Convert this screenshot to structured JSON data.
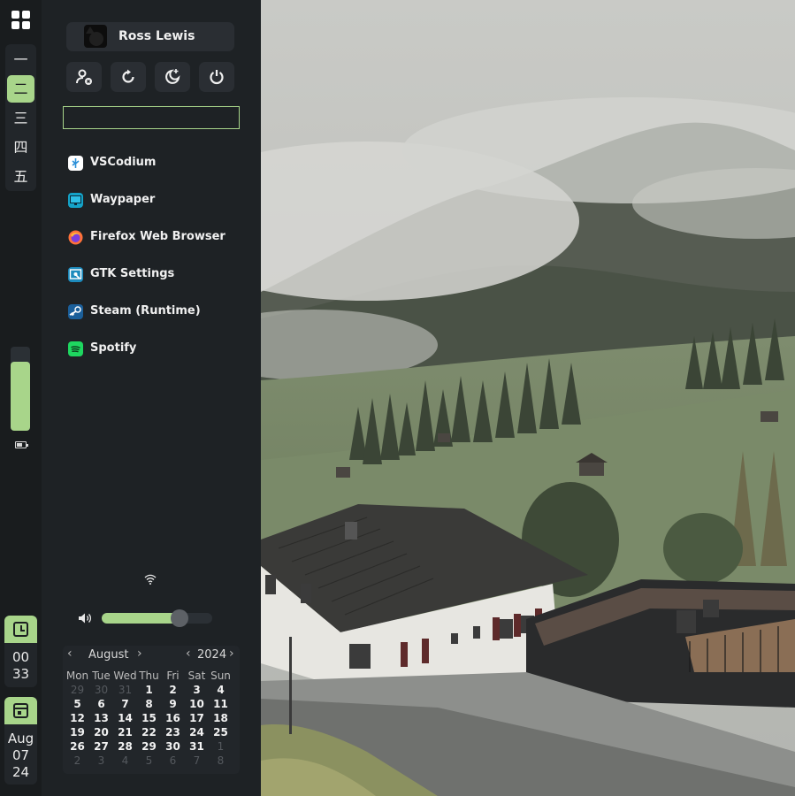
{
  "bar": {
    "workspaces": [
      {
        "label": "一",
        "active": false
      },
      {
        "label": "二",
        "active": true
      },
      {
        "label": "三",
        "active": false
      },
      {
        "label": "四",
        "active": false
      },
      {
        "label": "五",
        "active": false
      }
    ],
    "brightness_level": 0.82,
    "clock": {
      "hour": "00",
      "minute": "33"
    },
    "date": {
      "month": "Aug",
      "day": "07",
      "year": "24"
    }
  },
  "panel": {
    "user_name": "Ross Lewis",
    "power_buttons": [
      "logout-icon",
      "reboot-icon",
      "suspend-icon",
      "shutdown-icon"
    ],
    "search": {
      "value": "",
      "placeholder": ""
    },
    "apps": [
      {
        "label": "VSCodium",
        "icon": "vscodium-icon",
        "color": "#ffffff"
      },
      {
        "label": "Waypaper",
        "icon": "waypaper-icon",
        "color": "#1e8fc0"
      },
      {
        "label": "Firefox Web Browser",
        "icon": "firefox-icon",
        "color": "#ff7139"
      },
      {
        "label": "GTK Settings",
        "icon": "gtk-settings-icon",
        "color": "#2196c8"
      },
      {
        "label": "Steam (Runtime)",
        "icon": "steam-icon",
        "color": "#1b5f9a"
      },
      {
        "label": "Spotify",
        "icon": "spotify-icon",
        "color": "#1ed760"
      }
    ],
    "volume_level": 0.7,
    "calendar": {
      "month": "August",
      "year": "2024",
      "weekdays": [
        "Mon",
        "Tue",
        "Wed",
        "Thu",
        "Fri",
        "Sat",
        "Sun"
      ],
      "days": [
        "29",
        "30",
        "31",
        "1",
        "2",
        "3",
        "4",
        "5",
        "6",
        "7",
        "8",
        "9",
        "10",
        "11",
        "12",
        "13",
        "14",
        "15",
        "16",
        "17",
        "18",
        "19",
        "20",
        "21",
        "22",
        "23",
        "24",
        "25",
        "26",
        "27",
        "28",
        "29",
        "30",
        "31",
        "1",
        "2",
        "3",
        "4",
        "5",
        "6",
        "7",
        "8"
      ]
    }
  },
  "colors": {
    "accent": "#a8d58a",
    "panel_bg": "#1e2225",
    "bar_bg": "#191c1e"
  }
}
